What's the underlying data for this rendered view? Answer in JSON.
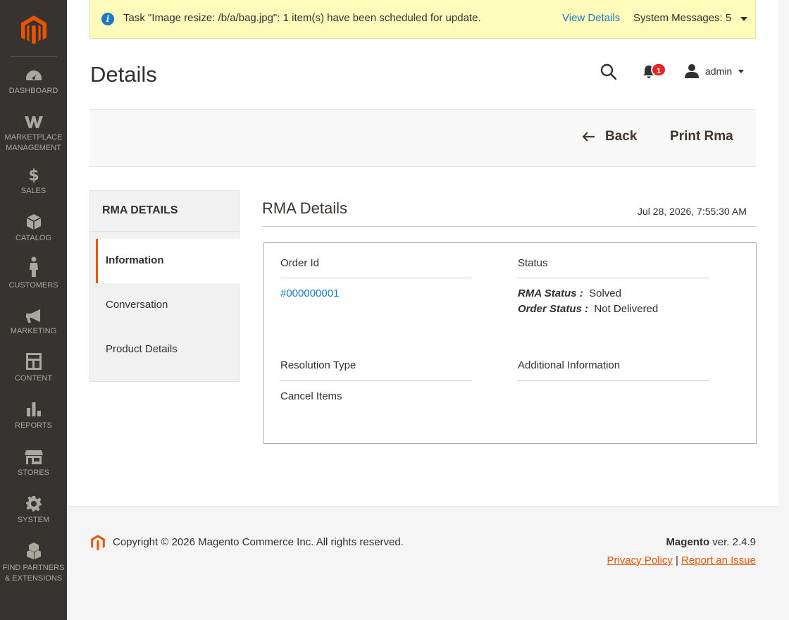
{
  "sidebar": {
    "items": [
      {
        "label": "DASHBOARD"
      },
      {
        "label": "MARKETPLACE MANAGEMENT"
      },
      {
        "label": "SALES"
      },
      {
        "label": "CATALOG"
      },
      {
        "label": "CUSTOMERS"
      },
      {
        "label": "MARKETING"
      },
      {
        "label": "CONTENT"
      },
      {
        "label": "REPORTS"
      },
      {
        "label": "STORES"
      },
      {
        "label": "SYSTEM"
      },
      {
        "label": "FIND PARTNERS & EXTENSIONS"
      }
    ]
  },
  "system_message": {
    "text": "Task \"Image resize: /b/a/bag.jpg\": 1 item(s) have been scheduled for update.",
    "view_details": "View Details",
    "count_label": "System Messages: 5"
  },
  "header": {
    "title": "Details",
    "notification_count": "1",
    "user": "admin"
  },
  "actions": {
    "back": "Back",
    "print": "Print Rma"
  },
  "tabs": {
    "title": "RMA DETAILS",
    "items": [
      {
        "label": "Information"
      },
      {
        "label": "Conversation"
      },
      {
        "label": "Product Details"
      }
    ]
  },
  "rma": {
    "section_title": "RMA Details",
    "date": "Jul 28, 2026, 7:55:30 AM",
    "order_id_title": "Order Id",
    "order_id": "#000000001",
    "status_title": "Status",
    "rma_status_key": "RMA Status :",
    "rma_status": "Solved",
    "order_status_key": "Order Status :",
    "order_status": "Not Delivered",
    "resolution_title": "Resolution Type",
    "resolution": "Cancel Items",
    "additional_title": "Additional Information"
  },
  "footer": {
    "copyright": "Copyright © 2026 Magento Commerce Inc. All rights reserved.",
    "brand": "Magento",
    "version": "ver. 2.4.9",
    "privacy": "Privacy Policy",
    "separator": "|",
    "report": "Report an Issue"
  },
  "colors": {
    "sidebar_bg": "#373330",
    "accent": "#eb5202",
    "link": "#1979c3",
    "message_bg": "#fffbbb",
    "badge": "#e22626"
  }
}
